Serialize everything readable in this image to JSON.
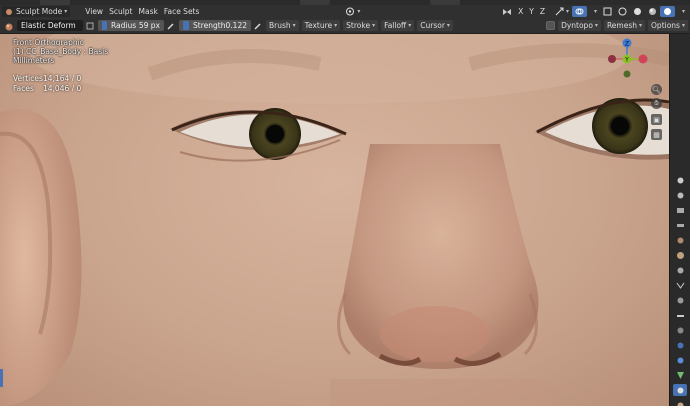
{
  "header": {
    "mode_label": "Sculpt Mode",
    "menus": [
      "View",
      "Sculpt",
      "Mask",
      "Face Sets"
    ],
    "axis_labels": [
      "X",
      "Y",
      "Z"
    ],
    "dyntopo_label": "Dyntopo",
    "remesh_label": "Remesh",
    "options_label": "Options"
  },
  "toolbar": {
    "brush_name": "Elastic Deform",
    "radius_label": "Radius",
    "radius_value": "59 px",
    "strength_label": "Strength",
    "strength_value": "0.122",
    "brush_menu": "Brush",
    "texture_menu": "Texture",
    "stroke_menu": "Stroke",
    "falloff_menu": "Falloff",
    "cursor_menu": "Cursor"
  },
  "viewport": {
    "view_name": "Front Orthographic",
    "object_name": "(1) CC_Base_Body : Basis",
    "units": "Millimeters",
    "stats": [
      {
        "label": "Vertices",
        "value": "14,164 / 0"
      },
      {
        "label": "Faces",
        "value": "14,046 / 0"
      }
    ]
  },
  "gizmo": {
    "z": "Z",
    "y": "Y",
    "x": "X"
  },
  "colors": {
    "accent": "#4772b3",
    "axis_x": "#d1435b",
    "axis_y": "#8bc02a",
    "axis_z": "#3c7bd6",
    "skin": "#caa58e",
    "iris": "#3f3a1c"
  }
}
